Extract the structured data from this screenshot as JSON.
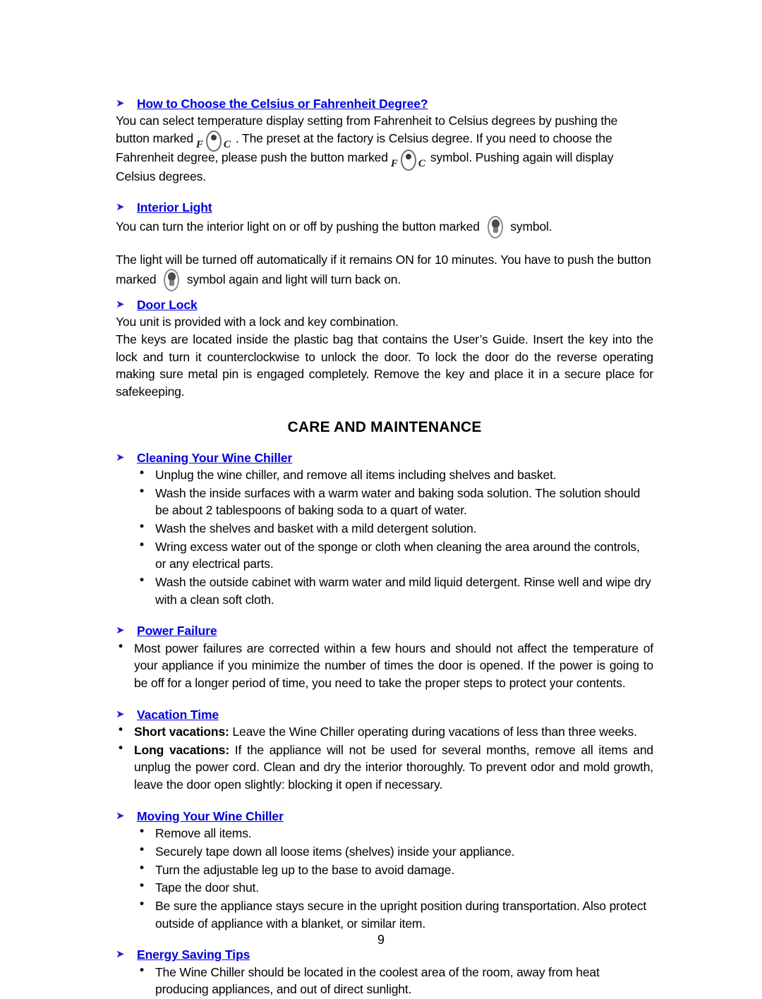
{
  "document": {
    "page_number": "9",
    "heading_color": "#0000dd",
    "arrow_bullet_color": "#2222cc",
    "text_color": "#000000"
  },
  "sections": {
    "celsius_fahrenheit": {
      "icon": "arrow-bullet-icon",
      "heading": "How to Choose the Celsius or Fahrenheit Degree?",
      "para_part1": "You can select temperature display setting from Fahrenheit to Celsius degrees by pushing the button marked",
      "para_part2": ". The preset at the factory is Celsius degree. If you need to choose the Fahrenheit degree, please push the button marked",
      "para_part3": "symbol. Pushing again will display Celsius degrees.",
      "symbol_f": "F",
      "symbol_c": "C"
    },
    "interior_light": {
      "icon": "arrow-bullet-icon",
      "heading": "Interior Light",
      "para1_part1": "You can turn the interior light on or off by pushing the button marked",
      "para1_part2": "symbol.",
      "para2_part1": "The light will be turned off automatically if it remains ON for 10 minutes. You have to push the button marked",
      "para2_part2": "symbol again and light will turn back on."
    },
    "door_lock": {
      "icon": "arrow-bullet-icon",
      "heading": "Door Lock",
      "para1": "You unit is provided with a lock and key combination.",
      "para2": "The keys are located inside the plastic bag that contains the User’s Guide. Insert the key into the lock and turn it counterclockwise to unlock the door. To lock the door do the reverse operating making sure metal pin is engaged completely. Remove the key and place it in a secure place for safekeeping."
    },
    "care_and_maintenance": {
      "title": "CARE AND MAINTENANCE"
    },
    "cleaning": {
      "icon": "arrow-bullet-icon",
      "heading": "Cleaning Your Wine Chiller",
      "bullets": [
        "Unplug the wine chiller, and remove all items including shelves and basket.",
        "Wash the inside surfaces with a warm water and baking soda solution. The solution should be about 2 tablespoons of baking soda to a quart of water.",
        "Wash the shelves and basket with a mild detergent solution.",
        "Wring excess water out of the sponge or cloth when cleaning the area around the controls, or any electrical parts.",
        "Wash the outside cabinet with warm water and mild liquid detergent.  Rinse well and wipe dry with a clean soft cloth."
      ]
    },
    "power_failure": {
      "icon": "arrow-bullet-icon",
      "heading": "Power Failure",
      "bullets": [
        "Most power failures are corrected within a few hours and should not affect the temperature of your appliance if you minimize the number of times the door is opened. If the power is going to be off for a longer period of time, you need to take the proper steps to protect your contents."
      ]
    },
    "vacation_time": {
      "icon": "arrow-bullet-icon",
      "heading": "Vacation Time",
      "bullets": [
        {
          "label": "Short vacations:",
          "text": " Leave the Wine Chiller operating during vacations of less than three weeks."
        },
        {
          "label": "Long vacations:",
          "text": " If the appliance will not be used for several months, remove all items and unplug the power cord.  Clean and dry the interior thoroughly.  To prevent odor and mold growth, leave the door open slightly: blocking it open if necessary."
        }
      ]
    },
    "moving": {
      "icon": "arrow-bullet-icon",
      "heading": "Moving Your Wine Chiller",
      "bullets": [
        "Remove all items.",
        "Securely tape down all loose items (shelves) inside your appliance.",
        "Turn the adjustable leg up to the base to avoid damage.",
        "Tape the door shut.",
        "Be sure the appliance stays secure in the upright position during transportation.  Also protect outside of appliance with a blanket, or similar item."
      ]
    },
    "energy_saving": {
      "icon": "arrow-bullet-icon",
      "heading": "Energy Saving Tips",
      "bullets": [
        "The Wine Chiller should be located in the coolest area of the room, away from heat producing appliances, and out of direct sunlight."
      ]
    }
  }
}
